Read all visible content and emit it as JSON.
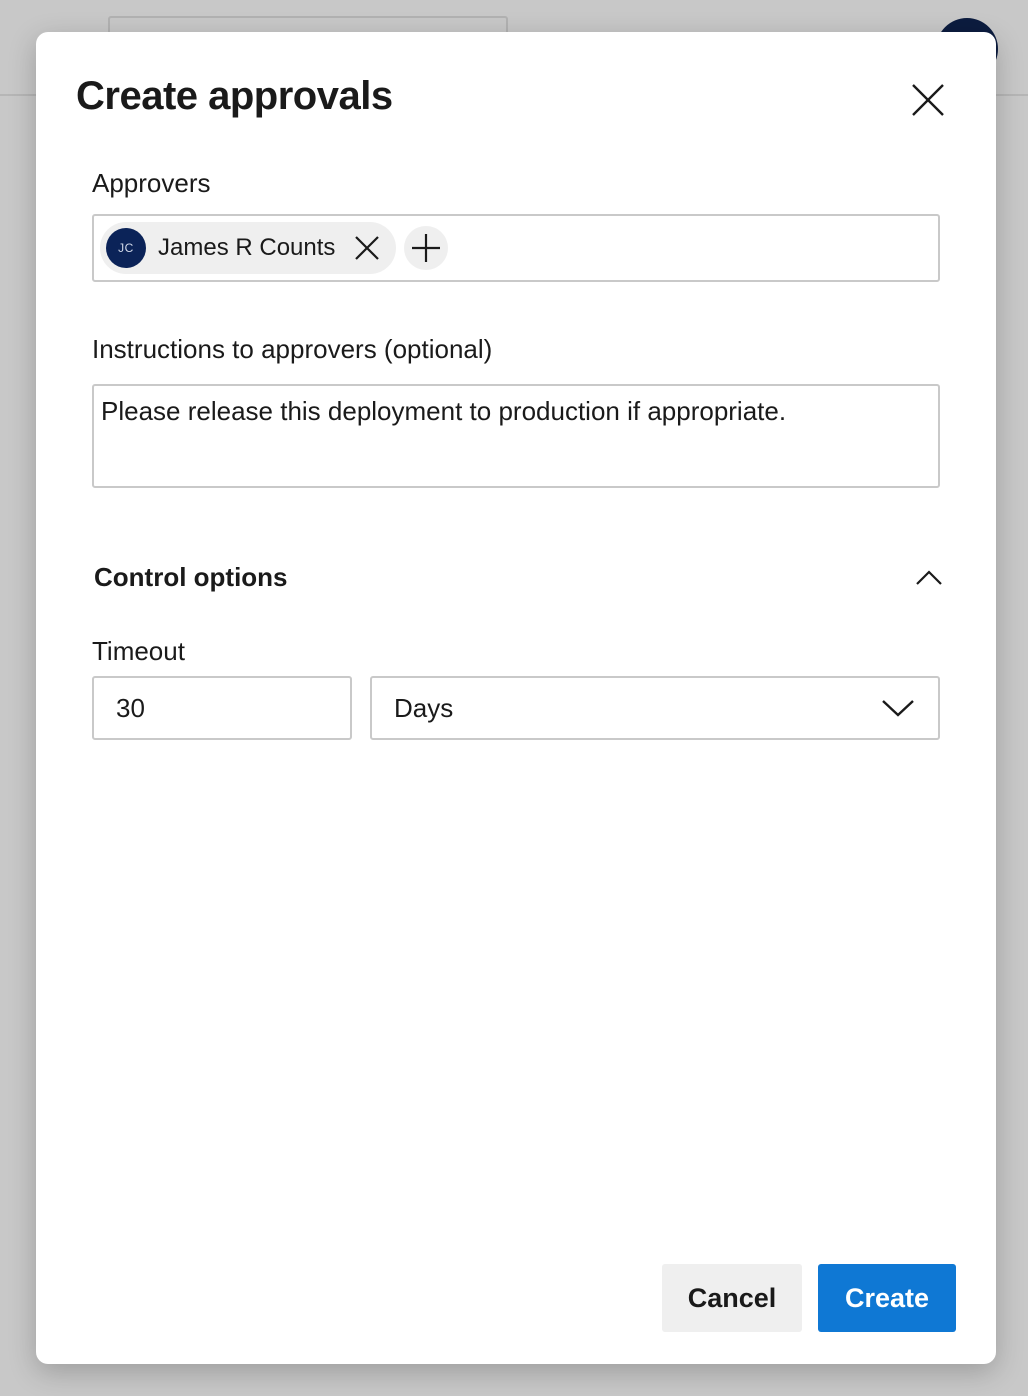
{
  "dialog": {
    "title": "Create approvals",
    "close_icon": "close-icon"
  },
  "approvers": {
    "label": "Approvers",
    "selected": [
      {
        "initials": "JC",
        "name": "James R Counts",
        "avatar_color": "#0b2358"
      }
    ],
    "remove_icon": "close-icon",
    "add_icon": "plus-icon"
  },
  "instructions": {
    "label": "Instructions to approvers (optional)",
    "value": "Please release this deployment to production if appropriate."
  },
  "control_options": {
    "title": "Control options",
    "expanded": true,
    "chevron_icon": "chevron-up-icon"
  },
  "timeout": {
    "label": "Timeout",
    "value": "30",
    "unit": "Days",
    "dropdown_icon": "chevron-down-icon"
  },
  "footer": {
    "cancel_label": "Cancel",
    "create_label": "Create"
  },
  "colors": {
    "primary": "#0f78d4",
    "overlay": "#c8c8c8",
    "secondary_button": "#efefef"
  }
}
